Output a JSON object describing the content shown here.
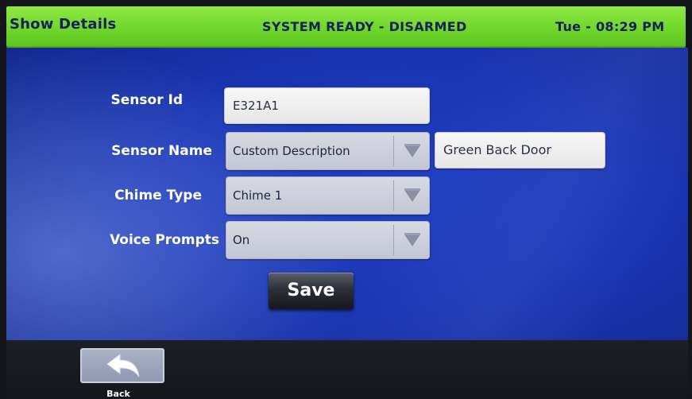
{
  "header": {
    "title": "Show Details",
    "status": "SYSTEM READY - DISARMED",
    "clock": "Tue - 08:29 PM"
  },
  "form": {
    "sensor_id": {
      "label": "Sensor Id",
      "value": "E321A1"
    },
    "sensor_name": {
      "label": "Sensor Name",
      "selected": "Custom Description",
      "custom_value": "Green Back Door"
    },
    "chime_type": {
      "label": "Chime Type",
      "selected": "Chime 1"
    },
    "voice_prompts": {
      "label": "Voice Prompts",
      "selected": "On"
    },
    "save_label": "Save"
  },
  "footer": {
    "back_label": "Back",
    "back_icon": "back-arrow-icon"
  },
  "colors": {
    "header_green": "#6fd62a",
    "header_text": "#16205a",
    "main_blue": "#1834b0",
    "dropdown_arrow": "#8a8fa3"
  }
}
